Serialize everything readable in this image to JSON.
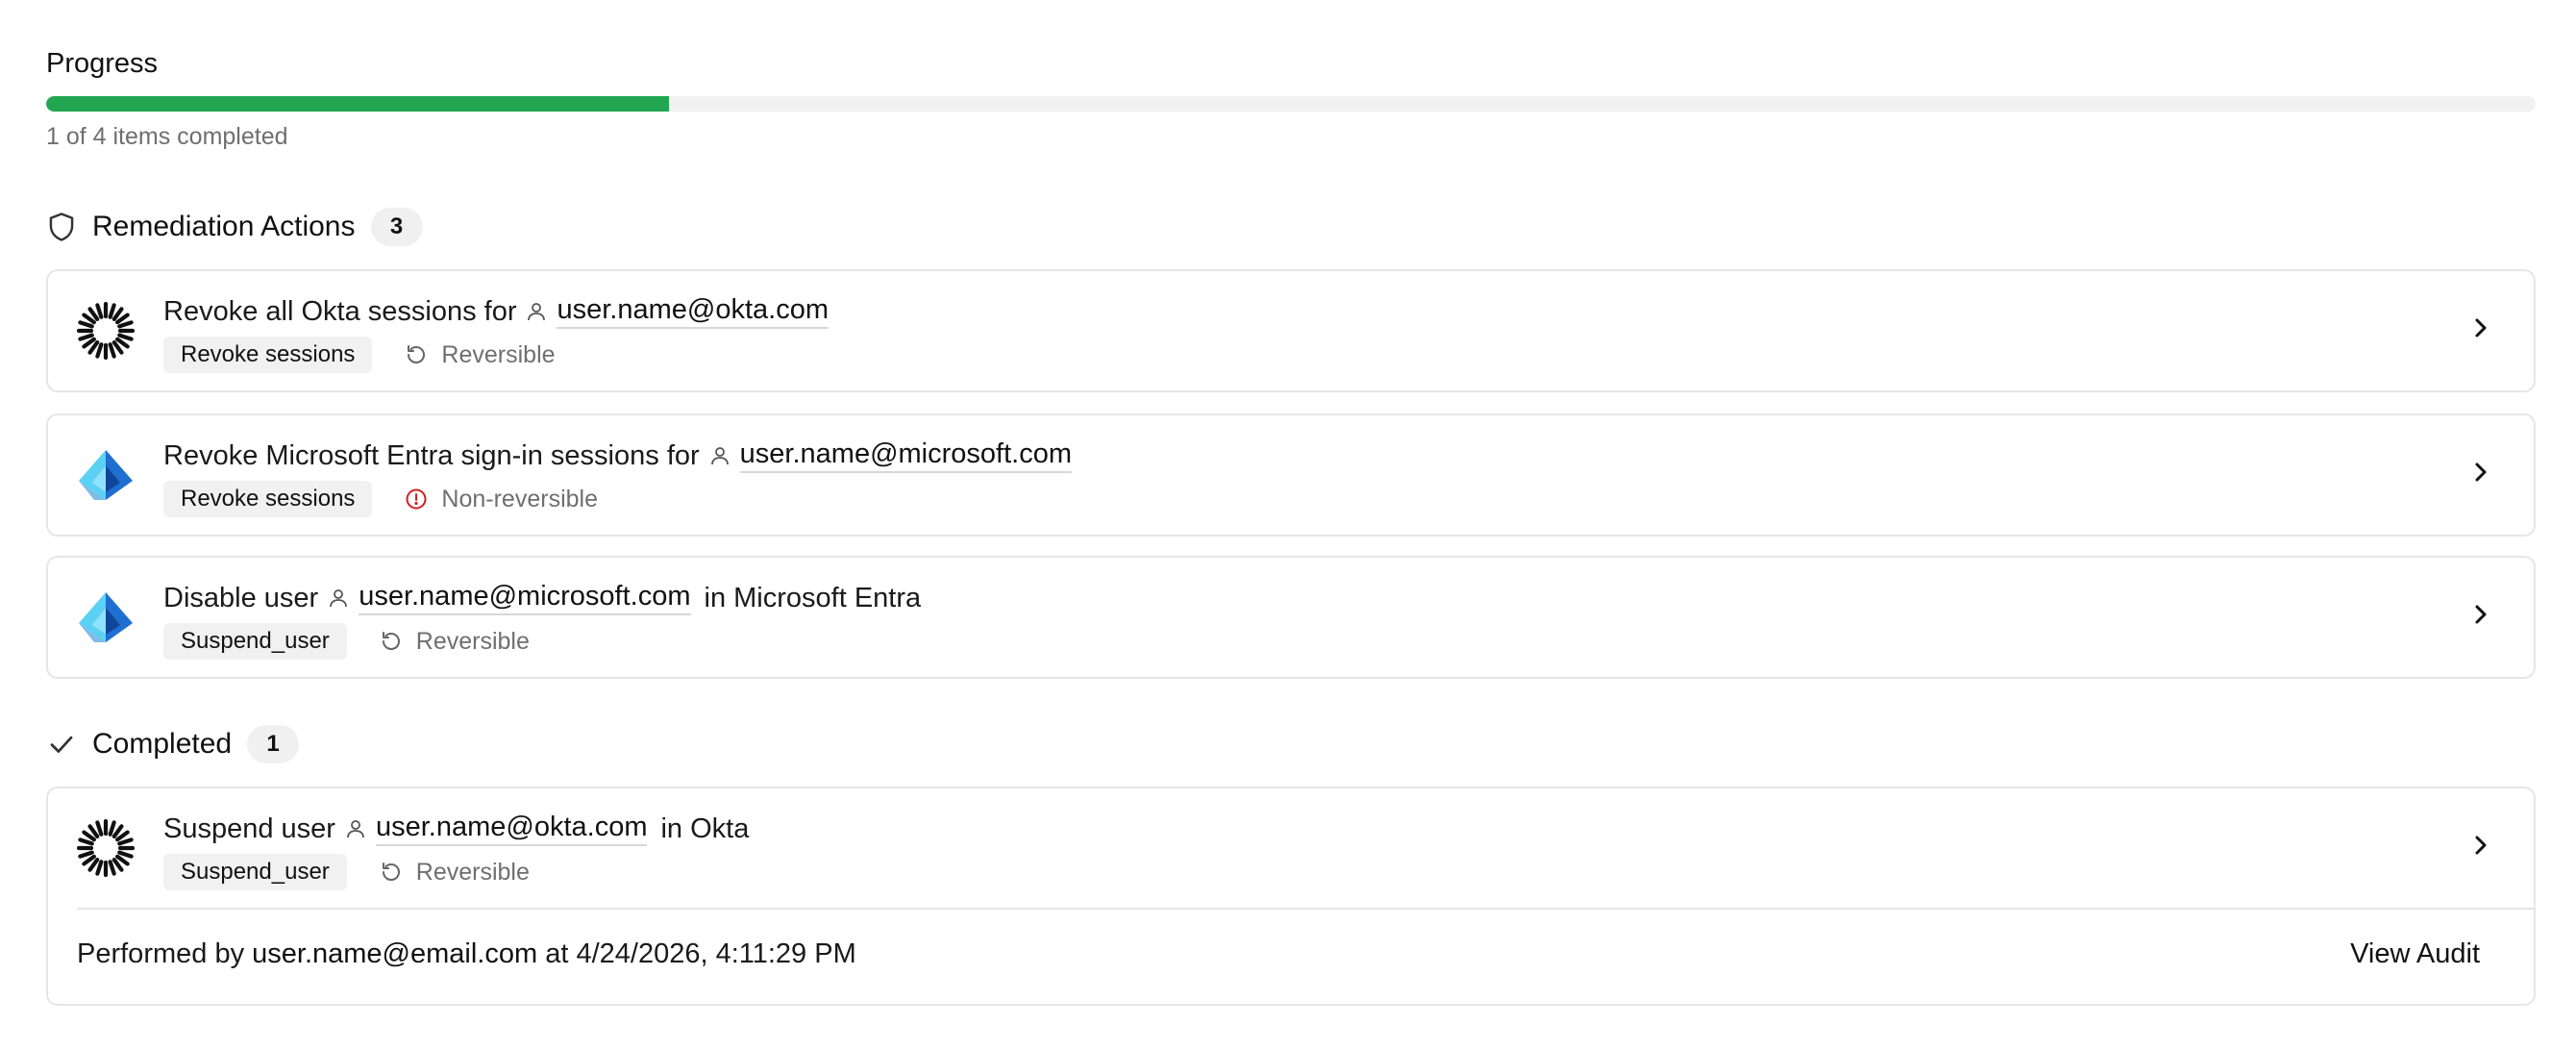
{
  "progress": {
    "title": "Progress",
    "completed": 1,
    "total": 4,
    "caption": "1 of 4 items completed",
    "fill_color": "#22a652"
  },
  "remediation": {
    "title": "Remediation Actions",
    "count": "3",
    "icon": "shield-icon",
    "items": [
      {
        "logo": "okta-logo",
        "title_prefix": "Revoke all Okta sessions for",
        "email": "user.name@okta.com",
        "title_suffix": "",
        "tag": "Revoke sessions",
        "reversibility": "Reversible",
        "reversibility_icon": "undo-icon"
      },
      {
        "logo": "microsoft-entra-logo",
        "title_prefix": "Revoke Microsoft Entra sign-in sessions for",
        "email": "user.name@microsoft.com",
        "title_suffix": "",
        "tag": "Revoke sessions",
        "reversibility": "Non-reversible",
        "reversibility_icon": "alert-circle-icon"
      },
      {
        "logo": "microsoft-entra-logo",
        "title_prefix": "Disable user",
        "email": "user.name@microsoft.com",
        "title_suffix": "in Microsoft Entra",
        "tag": "Suspend_user",
        "reversibility": "Reversible",
        "reversibility_icon": "undo-icon"
      }
    ]
  },
  "completed": {
    "title": "Completed",
    "count": "1",
    "icon": "check-icon",
    "items": [
      {
        "logo": "okta-logo",
        "title_prefix": "Suspend user",
        "email": "user.name@okta.com",
        "title_suffix": "in Okta",
        "tag": "Suspend_user",
        "reversibility": "Reversible",
        "reversibility_icon": "undo-icon",
        "performed_prefix": "Performed by",
        "performed_by": "user.name@email.com",
        "performed_at_prefix": "at",
        "performed_at": "4/24/2026, 4:11:29 PM",
        "view_audit_label": "View Audit"
      }
    ]
  }
}
